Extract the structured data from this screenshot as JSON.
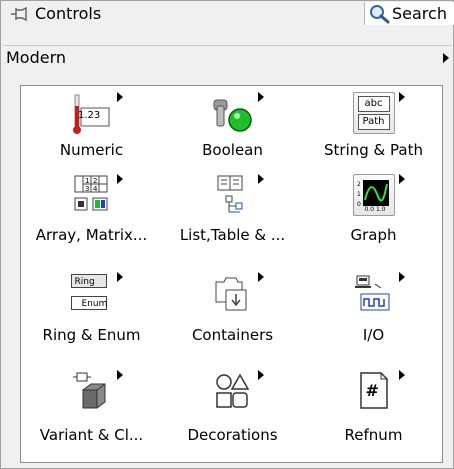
{
  "palette": {
    "title": "Controls",
    "search_label": "Search",
    "category": "Modern",
    "items": [
      {
        "label": "Numeric",
        "icon": "numeric-icon"
      },
      {
        "label": "Boolean",
        "icon": "boolean-icon"
      },
      {
        "label": "String & Path",
        "icon": "string-path-icon"
      },
      {
        "label": "Array, Matrix...",
        "icon": "array-matrix-icon"
      },
      {
        "label": "List,Table & ...",
        "icon": "list-table-icon"
      },
      {
        "label": "Graph",
        "icon": "graph-icon"
      },
      {
        "label": "Ring & Enum",
        "icon": "ring-enum-icon"
      },
      {
        "label": "Containers",
        "icon": "containers-icon"
      },
      {
        "label": "I/O",
        "icon": "io-icon"
      },
      {
        "label": "Variant & Cl...",
        "icon": "variant-class-icon"
      },
      {
        "label": "Decorations",
        "icon": "decorations-icon"
      },
      {
        "label": "Refnum",
        "icon": "refnum-icon"
      }
    ],
    "icon_text": {
      "numeric_value": "1.23",
      "string_abc": "abc",
      "string_path": "Path",
      "ring": "Ring",
      "enum": "Enum",
      "graph_ticks": "0.0 1.0",
      "refnum": "#",
      "array_cells": "1 2 3 4"
    },
    "colors": {
      "thermo_red": "#c0201a",
      "led_green": "#1fbf2a",
      "graph_green": "#3ce23c",
      "io_blue": "#1f3fbf"
    }
  }
}
